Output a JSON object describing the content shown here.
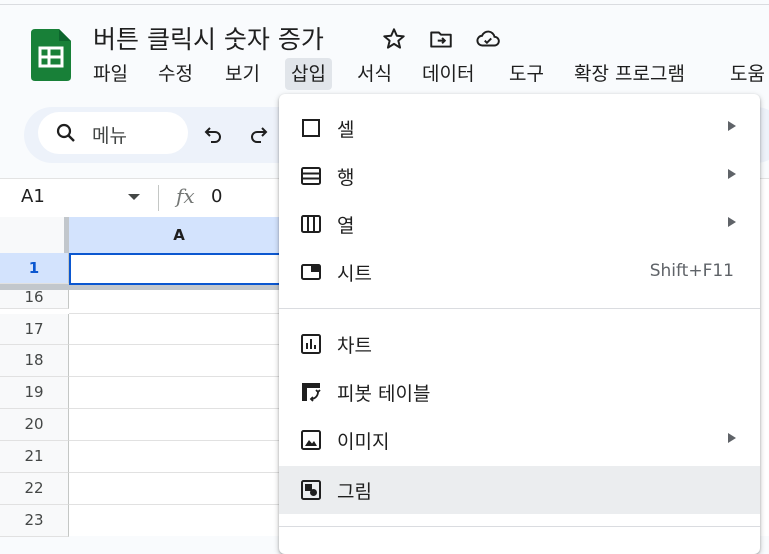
{
  "document": {
    "title": "버튼 클릭시 숫자 증가"
  },
  "menubar": {
    "items": [
      "파일",
      "수정",
      "보기",
      "삽입",
      "서식",
      "데이터",
      "도구",
      "확장 프로그램",
      "도움"
    ],
    "active": "삽입"
  },
  "toolbar": {
    "search_label": "메뉴"
  },
  "formula_bar": {
    "cell_ref": "A1",
    "fx": "fx",
    "value": "0"
  },
  "sheet": {
    "column_header": "A",
    "rows": [
      "1",
      "16",
      "17",
      "18",
      "19",
      "20",
      "21",
      "22",
      "23"
    ],
    "selected_cell": "A1"
  },
  "insert_menu": {
    "items": [
      {
        "label": "셀",
        "icon": "cell-square-icon",
        "submenu": true
      },
      {
        "label": "행",
        "icon": "rows-icon",
        "submenu": true
      },
      {
        "label": "열",
        "icon": "columns-icon",
        "submenu": true
      },
      {
        "label": "시트",
        "icon": "sheet-tab-icon",
        "shortcut": "Shift+F11"
      },
      {
        "label": "차트",
        "icon": "chart-icon"
      },
      {
        "label": "피봇 테이블",
        "icon": "pivot-table-icon"
      },
      {
        "label": "이미지",
        "icon": "image-icon",
        "submenu": true
      },
      {
        "label": "그림",
        "icon": "drawing-icon",
        "highlighted": true
      }
    ]
  },
  "colors": {
    "accent": "#0b57d0",
    "selected_header": "#d3e3fd",
    "logo": "#188038",
    "hover": "#ebedef"
  }
}
